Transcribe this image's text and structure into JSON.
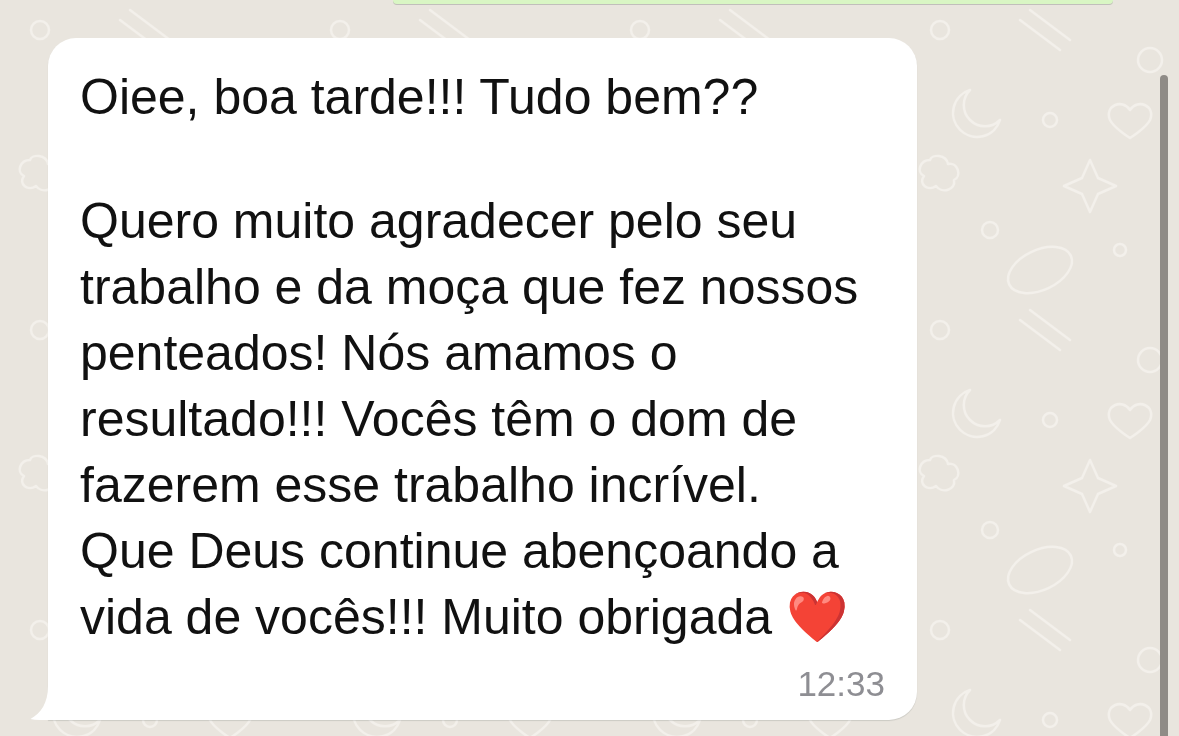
{
  "chat": {
    "messages": [
      {
        "kind": "outgoing"
      },
      {
        "kind": "incoming",
        "paragraphs": [
          "Oiee, boa tarde!!! Tudo bem??",
          "Quero muito agradecer pelo seu trabalho e da moça que fez nossos penteados! Nós amamos o resultado!!! Vocês têm o dom de fazerem esse trabalho incrível.\nQue Deus continue abençoando a vida de vocês!!! Muito obrigada ❤️"
        ],
        "time": "12:33"
      }
    ]
  }
}
